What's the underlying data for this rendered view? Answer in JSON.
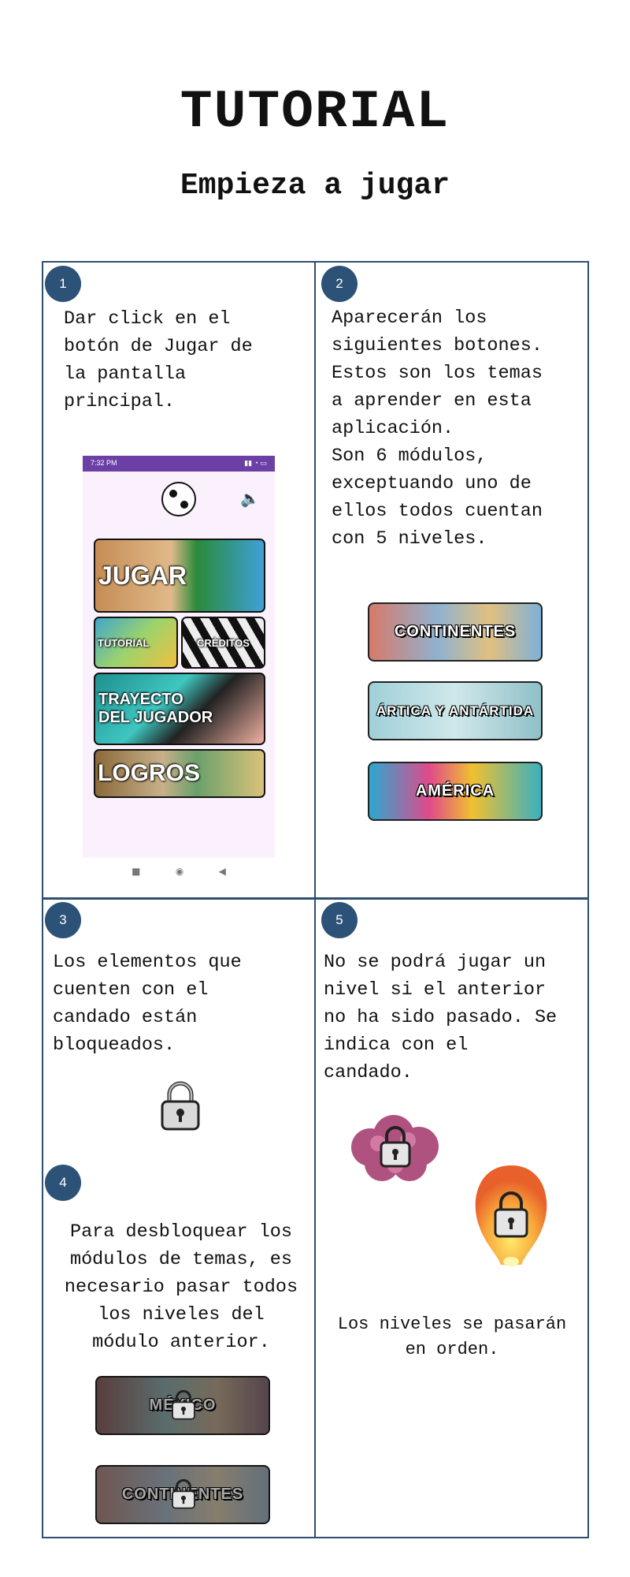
{
  "page": {
    "title": "TUTORIAL",
    "subtitle": "Empieza a jugar"
  },
  "steps": [
    {
      "number": "1",
      "lines": [
        "Dar click en el",
        "botón de Jugar de",
        "la pantalla",
        "principal."
      ]
    },
    {
      "number": "2",
      "lines": [
        "Aparecerán los",
        "siguientes botones.",
        "Estos son los temas",
        "a aprender en esta",
        "aplicación.",
        "Son 6 módulos,",
        "exceptuando uno de",
        "ellos todos cuentan",
        "con 5 niveles."
      ]
    },
    {
      "number": "3",
      "lines": [
        "Los elementos que",
        "cuenten con el",
        "candado están",
        "bloqueados."
      ]
    },
    {
      "number": "4",
      "lines": [
        "Para desbloquear los",
        "módulos de temas, es",
        "necesario pasar todos",
        "los niveles del",
        "módulo anterior."
      ]
    },
    {
      "number": "5",
      "lines": [
        "No se podrá jugar un",
        "nivel si el anterior",
        "no ha sido pasado. Se",
        "indica con el",
        "candado."
      ],
      "note_lines": [
        "Los niveles se pasarán",
        "en orden."
      ]
    }
  ],
  "phone": {
    "status_time": "7:32 PM",
    "tiles": {
      "jugar": "JUGAR",
      "tutorial": "TUTORIAL",
      "creditos": "CRÉDITOS",
      "trayecto_line1": "TRAYECTO",
      "trayecto_line2": "DEL JUGADOR",
      "logros": "LOGROS"
    },
    "nav_icons": [
      "square-icon",
      "circle-icon",
      "back-triangle-icon"
    ]
  },
  "topic_buttons": {
    "continentes": "CONTINENTES",
    "artica": "ÁRTICA Y ANTÁRTIDA",
    "america": "AMÉRICA",
    "mexico_locked": "MÉXICO",
    "continentes_locked": "CONTINENTES"
  },
  "colors": {
    "border": "#2f4f6f",
    "badge": "#2c5277",
    "status_bar": "#6b3fa6"
  }
}
